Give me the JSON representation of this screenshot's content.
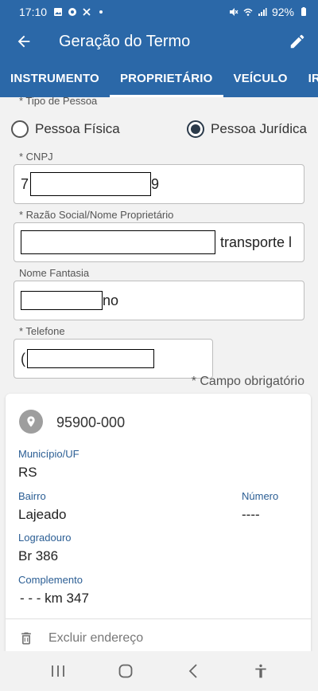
{
  "status_bar": {
    "time": "17:10",
    "battery": "92%"
  },
  "app_bar": {
    "title": "Geração do Termo"
  },
  "tabs": [
    {
      "label": "INSTRUMENTO"
    },
    {
      "label": "PROPRIETÁRIO"
    },
    {
      "label": "VEÍCULO"
    },
    {
      "label": "IRREG"
    }
  ],
  "form": {
    "tipo_pessoa_label": "* Tipo de Pessoa",
    "option_fisica": "Pessoa Física",
    "option_juridica": "Pessoa Jurídica",
    "selected": "Pessoa Jurídica",
    "cnpj_label": "* CNPJ",
    "cnpj_prefix": "7",
    "cnpj_suffix": "9",
    "razao_label": "* Razão Social/Nome Proprietário",
    "razao_suffix": "transporte l",
    "fantasia_label": "Nome Fantasia",
    "fantasia_suffix": "no",
    "telefone_label": "* Telefone",
    "telefone_prefix": "(",
    "required_note": "* Campo obrigatório"
  },
  "address": {
    "cep": "95900-000",
    "municipio_label": "Município/UF",
    "municipio_value": "RS",
    "bairro_label": "Bairro",
    "bairro_value": "Lajeado",
    "numero_label": "Número",
    "numero_value": "----",
    "logradouro_label": "Logradouro",
    "logradouro_value": "Br 386",
    "complemento_label": "Complemento",
    "complemento_value": "- - - km 347",
    "delete_label": "Excluir endereço"
  },
  "colors": {
    "primary": "#2b68a8",
    "label_blue": "#2b5e94"
  }
}
